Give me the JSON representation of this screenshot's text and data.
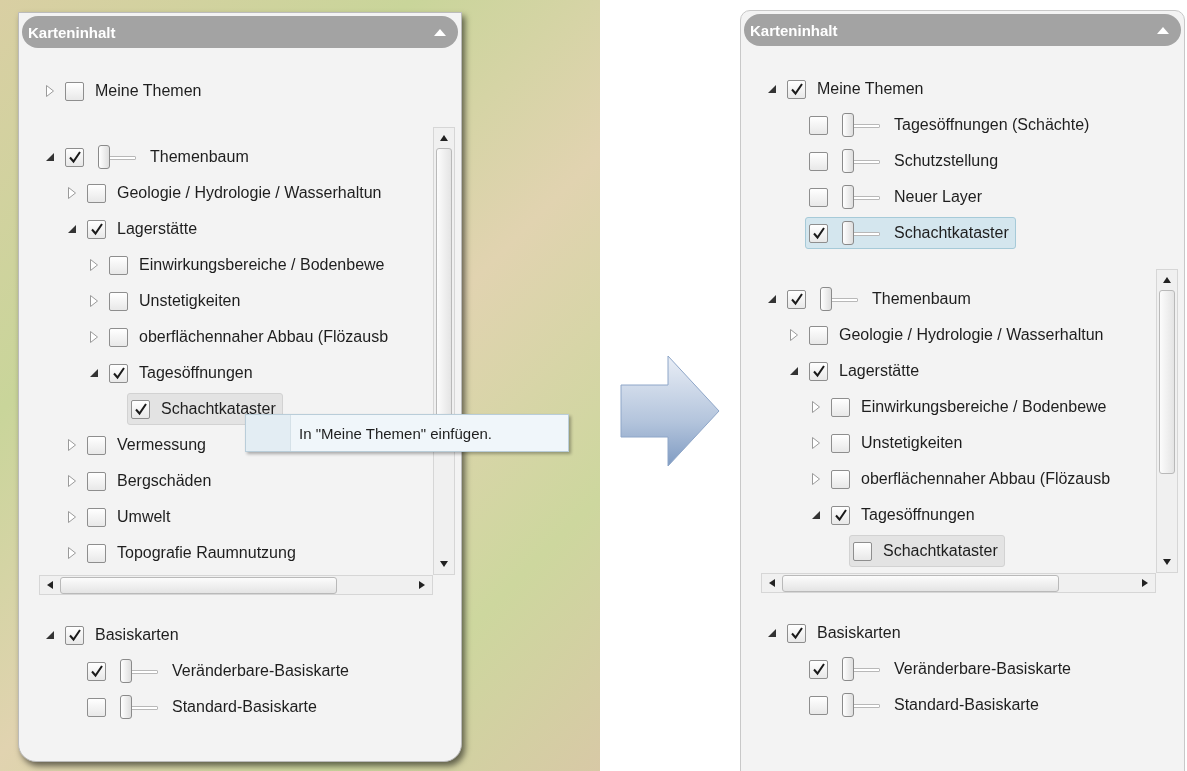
{
  "panels": [
    {
      "title": "Karteninhalt",
      "context_menu": {
        "items": [
          "In \"Meine Themen\" einfügen."
        ]
      },
      "sections": [
        {
          "kind": "plain",
          "nodes": [
            {
              "label": "Meine Themen",
              "expanded": false,
              "checked": false,
              "selected": false,
              "hovered": false
            }
          ]
        },
        {
          "kind": "scroll",
          "nodes": [
            {
              "label": "Themenbaum",
              "expanded": true,
              "checked": true,
              "selected": false,
              "hovered": false,
              "slider": {
                "level": 0
              },
              "children": [
                {
                  "label": "Geologie / Hydrologie / Wasserhaltun",
                  "expanded": false,
                  "checked": false,
                  "selected": false,
                  "hovered": false
                },
                {
                  "label": "Lagerstätte",
                  "expanded": true,
                  "checked": true,
                  "selected": false,
                  "hovered": false,
                  "children": [
                    {
                      "label": "Einwirkungsbereiche / Bodenbewe",
                      "expanded": false,
                      "checked": false,
                      "selected": false,
                      "hovered": false
                    },
                    {
                      "label": "Unstetigkeiten",
                      "expanded": false,
                      "checked": false,
                      "selected": false,
                      "hovered": false
                    },
                    {
                      "label": "oberflächennaher Abbau (Flözausb",
                      "expanded": false,
                      "checked": false,
                      "selected": false,
                      "hovered": false
                    },
                    {
                      "label": "Tagesöffnungen",
                      "expanded": true,
                      "checked": true,
                      "selected": false,
                      "hovered": false,
                      "children": [
                        {
                          "label": "Schachtkataster",
                          "checked": true,
                          "selected": false,
                          "hovered": true
                        }
                      ]
                    }
                  ]
                },
                {
                  "label": "Vermessung",
                  "expanded": false,
                  "checked": false,
                  "selected": false,
                  "hovered": false
                },
                {
                  "label": "Bergschäden",
                  "expanded": false,
                  "checked": false,
                  "selected": false,
                  "hovered": false
                },
                {
                  "label": "Umwelt",
                  "expanded": false,
                  "checked": false,
                  "selected": false,
                  "hovered": false
                },
                {
                  "label": "Topografie Raumnutzung",
                  "expanded": false,
                  "checked": false,
                  "selected": false,
                  "hovered": false
                }
              ]
            }
          ]
        },
        {
          "kind": "plain",
          "nodes": [
            {
              "label": "Basiskarten",
              "expanded": true,
              "checked": true,
              "selected": false,
              "hovered": false,
              "children": [
                {
                  "label": "Veränderbare-Basiskarte",
                  "checked": true,
                  "selected": false,
                  "hovered": false,
                  "slider": {
                    "level": 0
                  }
                },
                {
                  "label": "Standard-Basiskarte",
                  "checked": false,
                  "selected": false,
                  "hovered": false,
                  "slider": {
                    "level": 0
                  }
                }
              ]
            }
          ]
        }
      ]
    },
    {
      "title": "Karteninhalt",
      "sections": [
        {
          "kind": "plain",
          "nodes": [
            {
              "label": "Meine Themen",
              "expanded": true,
              "checked": true,
              "selected": false,
              "hovered": false,
              "children": [
                {
                  "label": "Tagesöffnungen (Schächte)",
                  "checked": false,
                  "selected": false,
                  "hovered": false,
                  "slider": {
                    "level": 0
                  }
                },
                {
                  "label": "Schutzstellung",
                  "checked": false,
                  "selected": false,
                  "hovered": false,
                  "slider": {
                    "level": 0
                  }
                },
                {
                  "label": "Neuer Layer",
                  "checked": false,
                  "selected": false,
                  "hovered": false,
                  "slider": {
                    "level": 0
                  }
                },
                {
                  "label": "Schachtkataster",
                  "checked": true,
                  "selected": true,
                  "hovered": false,
                  "slider": {
                    "level": 0
                  }
                }
              ]
            }
          ]
        },
        {
          "kind": "scroll",
          "nodes": [
            {
              "label": "Themenbaum",
              "expanded": true,
              "checked": true,
              "selected": false,
              "hovered": false,
              "slider": {
                "level": 0
              },
              "children": [
                {
                  "label": "Geologie / Hydrologie / Wasserhaltun",
                  "expanded": false,
                  "checked": false,
                  "selected": false,
                  "hovered": false
                },
                {
                  "label": "Lagerstätte",
                  "expanded": true,
                  "checked": true,
                  "selected": false,
                  "hovered": false,
                  "children": [
                    {
                      "label": "Einwirkungsbereiche / Bodenbewe",
                      "expanded": false,
                      "checked": false,
                      "selected": false,
                      "hovered": false
                    },
                    {
                      "label": "Unstetigkeiten",
                      "expanded": false,
                      "checked": false,
                      "selected": false,
                      "hovered": false
                    },
                    {
                      "label": "oberflächennaher Abbau (Flözausb",
                      "expanded": false,
                      "checked": false,
                      "selected": false,
                      "hovered": false
                    },
                    {
                      "label": "Tagesöffnungen",
                      "expanded": true,
                      "checked": true,
                      "selected": false,
                      "hovered": false,
                      "children": [
                        {
                          "label": "Schachtkataster",
                          "checked": false,
                          "selected": false,
                          "hovered": true
                        }
                      ]
                    }
                  ]
                }
              ]
            }
          ]
        },
        {
          "kind": "plain",
          "nodes": [
            {
              "label": "Basiskarten",
              "expanded": true,
              "checked": true,
              "selected": false,
              "hovered": false,
              "children": [
                {
                  "label": "Veränderbare-Basiskarte",
                  "checked": true,
                  "selected": false,
                  "hovered": false,
                  "slider": {
                    "level": 0
                  }
                },
                {
                  "label": "Standard-Basiskarte",
                  "checked": false,
                  "selected": false,
                  "hovered": false,
                  "slider": {
                    "level": 0
                  }
                }
              ]
            }
          ]
        }
      ]
    }
  ]
}
